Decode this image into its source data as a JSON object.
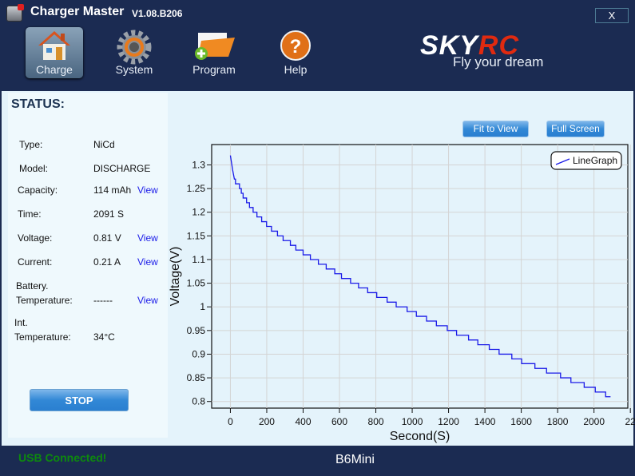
{
  "app": {
    "title": "Charger Master",
    "version": "V1.08.B206",
    "close_label": "X"
  },
  "toolbar": [
    {
      "label": "Charge",
      "icon": "house-icon",
      "active": true
    },
    {
      "label": "System",
      "icon": "gear-icon"
    },
    {
      "label": "Program",
      "icon": "folder-add-icon"
    },
    {
      "label": "Help",
      "icon": "help-icon"
    }
  ],
  "brand": {
    "logo_sky": "SKY",
    "logo_rc": "RC",
    "slogan": "Fly your dream",
    "accent": "#e02a10"
  },
  "status": {
    "title": "STATUS:",
    "rows": [
      {
        "key": "Type:",
        "value": "NiCd"
      },
      {
        "key": "Model:",
        "value": "DISCHARGE"
      },
      {
        "key": "Capacity:",
        "value": "114 mAh",
        "link": "View"
      },
      {
        "key": "Time:",
        "value": "2091 S"
      },
      {
        "key": "Voltage:",
        "value": "0.81 V",
        "link": "View"
      },
      {
        "key": "Current:",
        "value": "0.21 A",
        "link": "View"
      },
      {
        "key": "Battery.",
        "key2": "Temperature:",
        "value": "------",
        "link": "View"
      },
      {
        "key": "Int.",
        "key2": "Temperature:",
        "value": "34°C"
      }
    ],
    "stop_label": "STOP"
  },
  "chart_buttons": {
    "fit": "Fit to View",
    "full": "Full Screen"
  },
  "chart_data": {
    "type": "line",
    "title": "",
    "xlabel": "Second(S)",
    "ylabel": "Voltage(V)",
    "xlim": [
      -103,
      2186
    ],
    "ylim": [
      0.786,
      1.343
    ],
    "xticks": [
      0,
      200,
      400,
      600,
      800,
      1000,
      1200,
      1400,
      1600,
      1800,
      2000,
      2200
    ],
    "xtick_labels": [
      "0",
      "200",
      "400",
      "600",
      "800",
      "1000",
      "1200",
      "1400",
      "1600",
      "1800",
      "2000",
      "22"
    ],
    "yticks": [
      0.8,
      0.85,
      0.9,
      0.95,
      1,
      1.05,
      1.1,
      1.15,
      1.2,
      1.25,
      1.3
    ],
    "ytick_labels": [
      "0.8",
      "0.85",
      "0.9",
      "0.95",
      "1",
      "1.05",
      "1.1",
      "1.15",
      "1.2",
      "1.25",
      "1.3"
    ],
    "grid": true,
    "legend": {
      "position": "top-right",
      "entries": [
        "LineGraph"
      ]
    },
    "series": [
      {
        "name": "LineGraph",
        "color": "#1a1ae8",
        "x": [
          0,
          4,
          8,
          12,
          17,
          22,
          28,
          50,
          60,
          70,
          89,
          105,
          125,
          146,
          172,
          199,
          226,
          259,
          290,
          330,
          360,
          400,
          440,
          484,
          527,
          574,
          611,
          661,
          705,
          755,
          805,
          862,
          912,
          972,
          1023,
          1079,
          1133,
          1193,
          1244,
          1310,
          1361,
          1424,
          1478,
          1548,
          1602,
          1675,
          1739,
          1816,
          1873,
          1946,
          2007,
          2064,
          2091
        ],
        "y": [
          1.32,
          1.31,
          1.3,
          1.29,
          1.28,
          1.27,
          1.26,
          1.25,
          1.24,
          1.23,
          1.22,
          1.21,
          1.2,
          1.19,
          1.18,
          1.17,
          1.16,
          1.15,
          1.14,
          1.13,
          1.12,
          1.11,
          1.1,
          1.09,
          1.08,
          1.07,
          1.06,
          1.05,
          1.04,
          1.03,
          1.02,
          1.01,
          1.0,
          0.99,
          0.98,
          0.97,
          0.96,
          0.95,
          0.94,
          0.93,
          0.92,
          0.91,
          0.9,
          0.89,
          0.88,
          0.87,
          0.86,
          0.85,
          0.84,
          0.83,
          0.82,
          0.81,
          0.81
        ]
      }
    ]
  },
  "footer": {
    "usb_status": "USB  Connected!",
    "device": "B6Mini",
    "usb_color": "#0d8a0d"
  }
}
